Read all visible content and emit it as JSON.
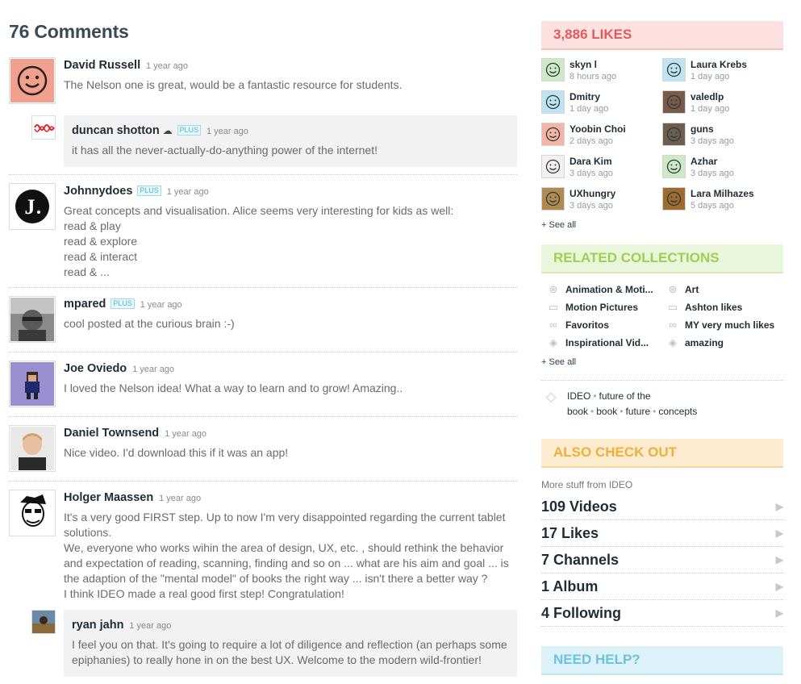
{
  "comments": {
    "title": "76 Comments",
    "items": [
      {
        "author": "David Russell",
        "time": "1 year ago",
        "plus": "",
        "lines": [
          "The Nelson one is great, would be a fantastic resource for students."
        ]
      },
      {
        "author": "duncan shotton",
        "time": "1 year ago",
        "plus": "PLUS",
        "lines": [
          "it has all the never-actually-do-anything power of the internet!"
        ]
      },
      {
        "author": "Johnnydoes",
        "time": "1 year ago",
        "plus": "PLUS",
        "lines": [
          "Great concepts and visualisation. Alice seems very interesting for kids as well:",
          "read & play",
          "read & explore",
          "read & interact",
          "read & ..."
        ]
      },
      {
        "author": "mpared",
        "time": "1 year ago",
        "plus": "PLUS",
        "lines": [
          "cool posted at the curious brain :-)"
        ]
      },
      {
        "author": "Joe Oviedo",
        "time": "1 year ago",
        "plus": "",
        "lines": [
          "I loved the Nelson idea! What a way to learn and to grow! Amazing.."
        ]
      },
      {
        "author": "Daniel Townsend",
        "time": "1 year ago",
        "plus": "",
        "lines": [
          "Nice video. I'd download this if it was an app!"
        ]
      },
      {
        "author": "Holger Maassen",
        "time": "1 year ago",
        "plus": "",
        "lines": [
          "It's a very good FIRST step. Up to now I'm very disappointed regarding the current tablet solutions.",
          "We, everyone who works wihin the area of design, UX, etc. , should rethink the behavior and expectation of reading, scanning, finding and so on ... what are his aim and goal ... is the adaption of the \"mental model\" of books the right way ... isn't there a better way ?",
          "I think IDEO made a real good first step! Congratulation!"
        ]
      },
      {
        "author": "ryan jahn",
        "time": "1 year ago",
        "plus": "",
        "lines": [
          "I feel you on that. It's going to require a lot of diligence and reflection (an perhaps some epiphanies) to really hone in on the best UX. Welcome to the modern wild-frontier!"
        ]
      }
    ]
  },
  "likes": {
    "title": "3,886 LIKES",
    "see_all": "+ See all",
    "people": [
      {
        "name": "skyn l",
        "time": "8 hours ago",
        "color": "#cfe9c7"
      },
      {
        "name": "Laura Krebs",
        "time": "1 day ago",
        "color": "#bfe3f2"
      },
      {
        "name": "Dmitry",
        "time": "1 day ago",
        "color": "#bfe3f2"
      },
      {
        "name": "valedlp",
        "time": "1 day ago",
        "color": "#7a5a4a"
      },
      {
        "name": "Yoobin Choi",
        "time": "2 days ago",
        "color": "#f4b5a6"
      },
      {
        "name": "guns",
        "time": "3 days ago",
        "color": "#6e5e50"
      },
      {
        "name": "Dara Kim",
        "time": "3 days ago",
        "color": "#f4f0f2"
      },
      {
        "name": "Azhar",
        "time": "3 days ago",
        "color": "#cfe9c7"
      },
      {
        "name": "UXhungry",
        "time": "3 days ago",
        "color": "#b08a50"
      },
      {
        "name": "Lara Milhazes",
        "time": "5 days ago",
        "color": "#a06a30"
      }
    ]
  },
  "collections": {
    "title": "RELATED COLLECTIONS",
    "see_all": "+ See all",
    "items": [
      {
        "label": "Animation & Moti...",
        "icon": "⊛"
      },
      {
        "label": "Art",
        "icon": "⊛"
      },
      {
        "label": "Motion Pictures",
        "icon": "▭"
      },
      {
        "label": "Ashton likes",
        "icon": "▭"
      },
      {
        "label": "Favoritos",
        "icon": "∞"
      },
      {
        "label": "MY very much likes",
        "icon": "∞"
      },
      {
        "label": "Inspirational Vid...",
        "icon": "◈"
      },
      {
        "label": "amazing",
        "icon": "◈"
      }
    ],
    "tags": [
      "IDEO",
      "future of the book",
      "book",
      "future",
      "concepts"
    ]
  },
  "also": {
    "title": "ALSO CHECK OUT",
    "more_prefix": "More stuff from ",
    "owner": "IDEO",
    "stats": [
      "109 Videos",
      "17 Likes",
      "7 Channels",
      "1 Album",
      "4 Following"
    ],
    "arrow": "▶"
  },
  "help": {
    "title": "NEED HELP?"
  }
}
